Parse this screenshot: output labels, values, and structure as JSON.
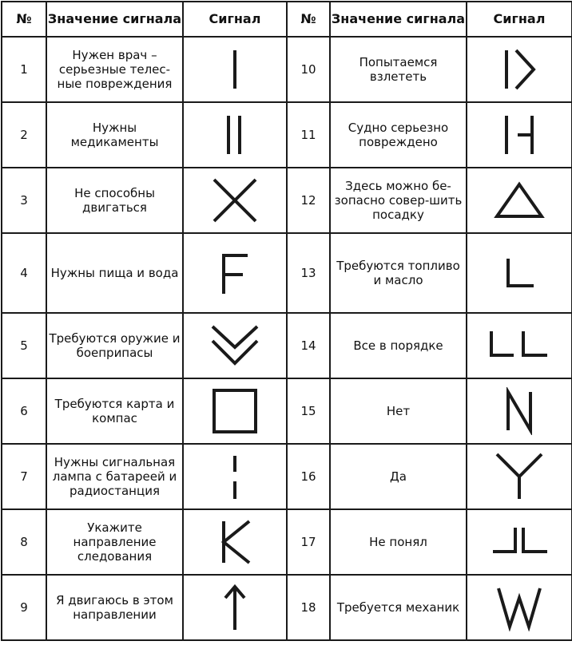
{
  "headers": {
    "num": "№",
    "meaning": "Значение сигнала",
    "signal": "Сигнал"
  },
  "rows": [
    {
      "num": "1",
      "meaning": "Нужен врач – серьезные телес-ные повреждения",
      "icon": "single-bar-icon"
    },
    {
      "num": "2",
      "meaning": "Нужны медикаменты",
      "icon": "double-bar-icon"
    },
    {
      "num": "3",
      "meaning": "Не способны двигаться",
      "icon": "x-cross-icon"
    },
    {
      "num": "4",
      "meaning": "Нужны пища и вода",
      "icon": "f-shape-icon"
    },
    {
      "num": "5",
      "meaning": "Требуются оружие и боеприпасы",
      "icon": "double-chevron-down-icon"
    },
    {
      "num": "6",
      "meaning": "Требуются карта и компас",
      "icon": "square-icon"
    },
    {
      "num": "7",
      "meaning": "Нужны сигнальная лампа с батареей и радиостанция",
      "icon": "dashed-bar-icon"
    },
    {
      "num": "8",
      "meaning": "Укажите направление следования",
      "icon": "k-shape-icon"
    },
    {
      "num": "9",
      "meaning": "Я двигаюсь в этом направлении",
      "icon": "arrow-up-icon"
    },
    {
      "num": "10",
      "meaning": "Попытаемся взлететь",
      "icon": "bar-chevron-right-icon"
    },
    {
      "num": "11",
      "meaning": "Судно серьезно повреждено",
      "icon": "bar-half-h-icon"
    },
    {
      "num": "12",
      "meaning": "Здесь можно бе-зопасно совер-шить посадку",
      "icon": "triangle-icon"
    },
    {
      "num": "13",
      "meaning": "Требуются топливо и масло",
      "icon": "l-shape-icon"
    },
    {
      "num": "14",
      "meaning": "Все в порядке",
      "icon": "double-l-icon"
    },
    {
      "num": "15",
      "meaning": "Нет",
      "icon": "n-shape-icon"
    },
    {
      "num": "16",
      "meaning": "Да",
      "icon": "y-shape-icon"
    },
    {
      "num": "17",
      "meaning": "Не понял",
      "icon": "jl-shape-icon"
    },
    {
      "num": "18",
      "meaning": "Требуется механик",
      "icon": "w-shape-icon"
    }
  ]
}
